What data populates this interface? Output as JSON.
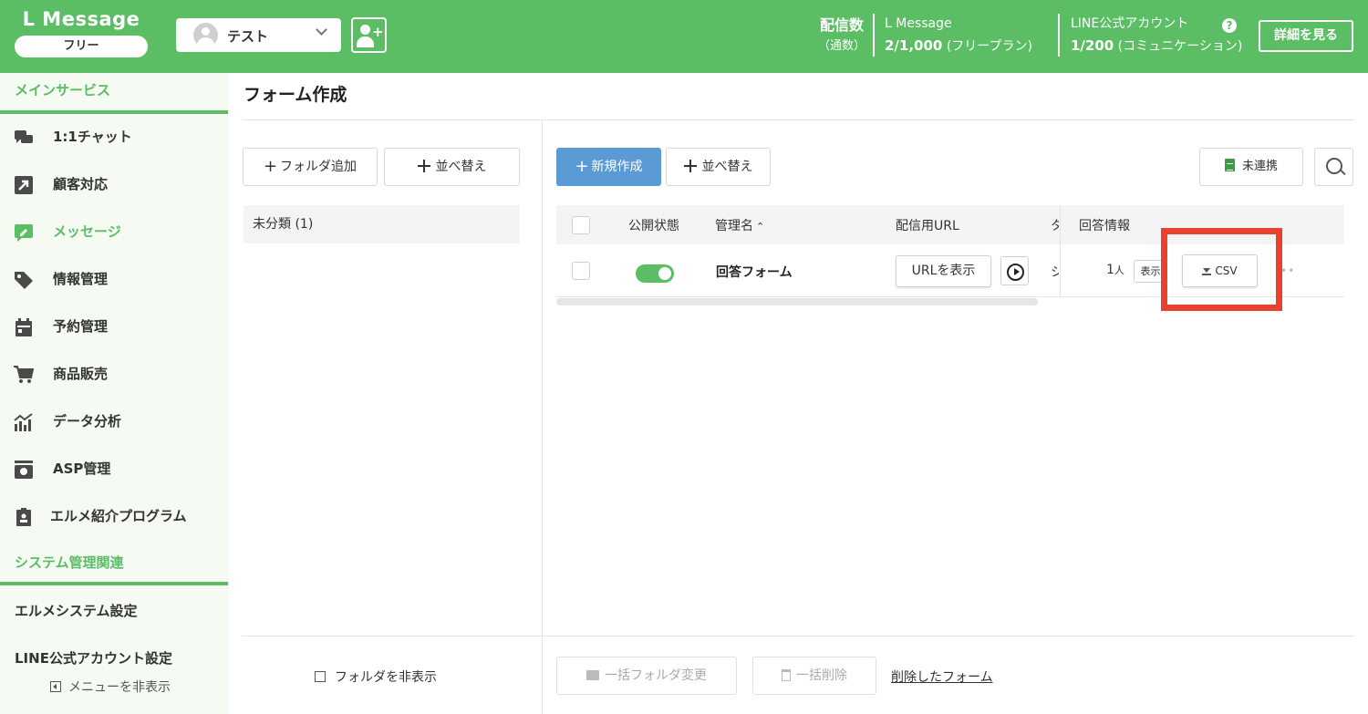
{
  "colors": {
    "brand_green": "#5bbd64",
    "primary_blue": "#5b9bd5",
    "highlight_red": "#e8422e"
  },
  "header": {
    "brand": "L Message",
    "plan": "フリー",
    "account_name": "テスト",
    "send_label": "配信数",
    "send_sub": "（通数）",
    "lmessage_label": "L Message",
    "lmessage_value": "2/1,000",
    "lmessage_suffix": " (フリープラン)",
    "line_label": "LINE公式アカウント",
    "line_value": "1/200",
    "line_suffix": " (コミュニケーション)",
    "help": "?",
    "detail_button": "詳細を見る"
  },
  "sidebar": {
    "section_main": "メインサービス",
    "items": [
      {
        "label": "1:1チャット",
        "icon": "chat-icon"
      },
      {
        "label": "顧客対応",
        "icon": "arrow-icon"
      },
      {
        "label": "メッセージ",
        "icon": "message-edit-icon"
      },
      {
        "label": "情報管理",
        "icon": "tag-icon"
      },
      {
        "label": "予約管理",
        "icon": "calendar-icon"
      },
      {
        "label": "商品販売",
        "icon": "cart-icon"
      },
      {
        "label": "データ分析",
        "icon": "chart-icon"
      },
      {
        "label": "ASP管理",
        "icon": "asp-icon"
      },
      {
        "label": "エルメ紹介プログラム",
        "icon": "clipboard-icon"
      }
    ],
    "section_system": "システム管理関連",
    "system_settings": "エルメシステム設定",
    "line_settings": "LINE公式アカウント設定",
    "hide_menu": "メニューを非表示"
  },
  "main": {
    "title": "フォーム作成",
    "add_folder": "フォルダ追加",
    "sort": "並べ替え",
    "folder": "未分類 (1)",
    "new": "新規作成",
    "sheets": "未連携",
    "table": {
      "col_status": "公開状態",
      "col_name": "管理名",
      "col_url": "配信用URL",
      "col_trunc": "タ",
      "col_answers": "回答情報",
      "row": {
        "name": "回答フォーム",
        "url_button": "URLを表示",
        "trunc": "シ",
        "count": "1",
        "count_unit": "人",
        "show": "表示",
        "csv": "CSV",
        "published": true
      }
    },
    "hide_folders": "フォルダを非表示",
    "bulk_folder": "一括フォルダ変更",
    "bulk_delete": "一括削除",
    "deleted_forms": "削除したフォーム"
  }
}
